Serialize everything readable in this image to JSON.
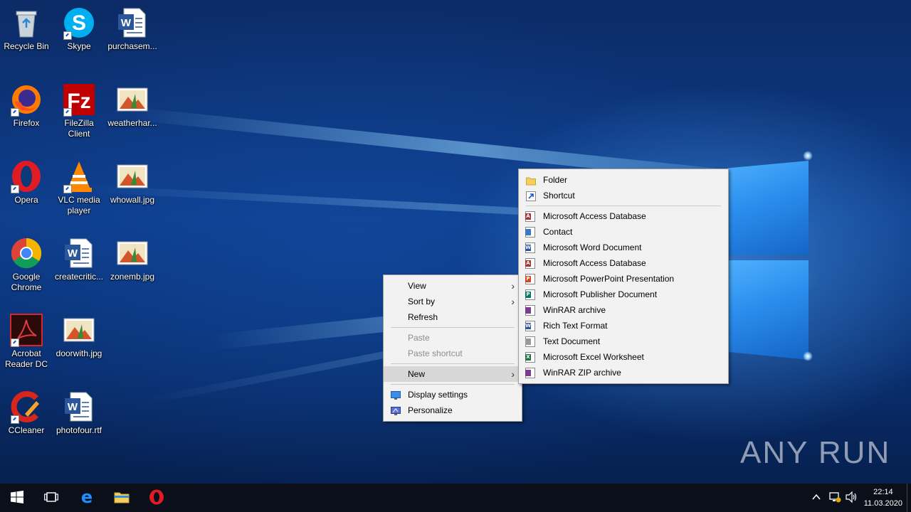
{
  "desktop_icons": [
    {
      "label": "Recycle Bin",
      "icon": "recycle-bin-icon"
    },
    {
      "label": "Skype",
      "icon": "skype-icon"
    },
    {
      "label": "purchasem...",
      "icon": "word-document-icon"
    },
    {
      "label": "Firefox",
      "icon": "firefox-icon"
    },
    {
      "label": "FileZilla Client",
      "icon": "filezilla-icon"
    },
    {
      "label": "weatherhar...",
      "icon": "image-file-icon"
    },
    {
      "label": "Opera",
      "icon": "opera-icon"
    },
    {
      "label": "VLC media player",
      "icon": "vlc-icon"
    },
    {
      "label": "whowall.jpg",
      "icon": "image-file-icon"
    },
    {
      "label": "Google Chrome",
      "icon": "chrome-icon"
    },
    {
      "label": "createcritic...",
      "icon": "word-document-icon"
    },
    {
      "label": "zonemb.jpg",
      "icon": "image-file-icon"
    },
    {
      "label": "Acrobat Reader DC",
      "icon": "acrobat-icon"
    },
    {
      "label": "doorwith.jpg",
      "icon": "image-file-icon"
    },
    {
      "label": "CCleaner",
      "icon": "ccleaner-icon"
    },
    {
      "label": "photofour.rtf",
      "icon": "word-document-icon"
    }
  ],
  "context_menu": {
    "view": "View",
    "sort_by": "Sort by",
    "refresh": "Refresh",
    "paste": "Paste",
    "paste_shortcut": "Paste shortcut",
    "new": "New",
    "display_settings": "Display settings",
    "personalize": "Personalize"
  },
  "new_submenu": {
    "folder": "Folder",
    "shortcut": "Shortcut",
    "items": [
      {
        "label": "Microsoft Access Database",
        "icon": "access-icon",
        "color": "#a4373a",
        "letter": "A"
      },
      {
        "label": "Contact",
        "icon": "contact-icon",
        "color": "#3a78c2",
        "letter": ""
      },
      {
        "label": "Microsoft Word Document",
        "icon": "word-icon",
        "color": "#2b579a",
        "letter": "W"
      },
      {
        "label": "Microsoft Access Database",
        "icon": "access-icon",
        "color": "#a4373a",
        "letter": "A"
      },
      {
        "label": "Microsoft PowerPoint Presentation",
        "icon": "powerpoint-icon",
        "color": "#d24726",
        "letter": "P"
      },
      {
        "label": "Microsoft Publisher Document",
        "icon": "publisher-icon",
        "color": "#077568",
        "letter": "P"
      },
      {
        "label": "WinRAR archive",
        "icon": "winrar-icon",
        "color": "#7a3c8c",
        "letter": ""
      },
      {
        "label": "Rich Text Format",
        "icon": "rtf-icon",
        "color": "#2b579a",
        "letter": "W"
      },
      {
        "label": "Text Document",
        "icon": "text-document-icon",
        "color": "#9a9a9a",
        "letter": ""
      },
      {
        "label": "Microsoft Excel Worksheet",
        "icon": "excel-icon",
        "color": "#217346",
        "letter": "X"
      },
      {
        "label": "WinRAR ZIP archive",
        "icon": "winrar-zip-icon",
        "color": "#7a3c8c",
        "letter": ""
      }
    ]
  },
  "taskbar": {
    "time": "22:14",
    "date": "11.03.2020"
  },
  "watermark": "ANY RUN",
  "colors": {
    "menu_bg": "#f2f2f2",
    "menu_highlight": "#d7d7d7",
    "taskbar_bg": "#0b0f19",
    "accent": "#0078d7"
  }
}
